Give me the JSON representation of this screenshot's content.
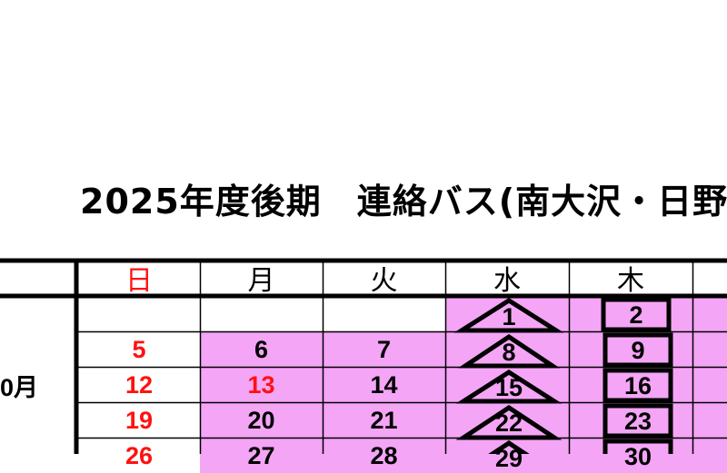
{
  "title": "2025年度後期　連絡バス(南大沢・日野",
  "weekday_headers": [
    "日",
    "月",
    "火",
    "水",
    "木"
  ],
  "month_label": "0月",
  "rows": [
    [
      "",
      "",
      "",
      "1",
      "2"
    ],
    [
      "5",
      "6",
      "7",
      "8",
      "9"
    ],
    [
      "12",
      "13",
      "14",
      "15",
      "16"
    ],
    [
      "19",
      "20",
      "21",
      "22",
      "23"
    ],
    [
      "26",
      "27",
      "28",
      "29",
      "30"
    ]
  ],
  "red_dates": [
    "5",
    "12",
    "13",
    "19",
    "26"
  ],
  "colors": {
    "operation_day": "#f4a5f6",
    "holiday_text": "#ff1111",
    "text": "#000000"
  },
  "legend_marks": {
    "wednesday": "triangle-mark",
    "thursday": "square-mark"
  }
}
